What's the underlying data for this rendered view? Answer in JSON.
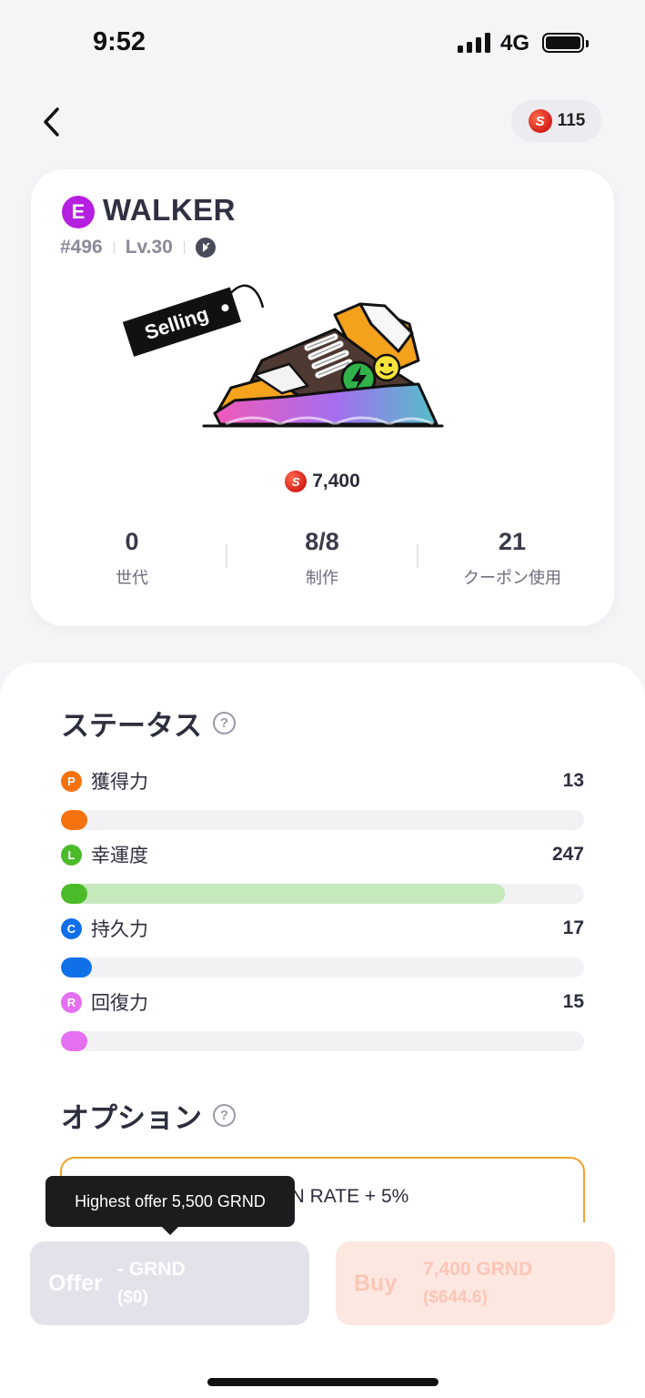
{
  "status_bar": {
    "time": "9:52",
    "network": "4G"
  },
  "header": {
    "balance": "115",
    "coin_symbol": "S"
  },
  "card": {
    "rarity_letter": "E",
    "name": "WALKER",
    "token_id": "#496",
    "level": "Lv.30",
    "tag_label": "Selling",
    "price": "7,400",
    "stats": [
      {
        "value": "0",
        "label": "世代"
      },
      {
        "value": "8/8",
        "label": "制作"
      },
      {
        "value": "21",
        "label": "クーポン使用"
      }
    ]
  },
  "status_section": {
    "title": "ステータス",
    "help": "?",
    "attributes": [
      {
        "letter": "P",
        "name": "獲得力",
        "value": "13",
        "color": "#f5720f",
        "fill": 0.05
      },
      {
        "letter": "L",
        "name": "幸運度",
        "value": "247",
        "color": "#4cbb2a",
        "fill": 0.85
      },
      {
        "letter": "C",
        "name": "持久力",
        "value": "17",
        "color": "#1170e8",
        "fill": 0.06
      },
      {
        "letter": "R",
        "name": "回復力",
        "value": "15",
        "color": "#e46ff0",
        "fill": 0.05
      }
    ]
  },
  "options_section": {
    "title": "オプション",
    "help": "?",
    "option_text": "N RATE + 5%"
  },
  "tooltip": {
    "text": "Highest offer 5,500 GRND"
  },
  "actions": {
    "offer": {
      "label": "Offer",
      "amount": "- GRND",
      "sub": "($0)"
    },
    "buy": {
      "label": "Buy",
      "amount": "7,400 GRND",
      "sub": "($644.6)"
    }
  }
}
